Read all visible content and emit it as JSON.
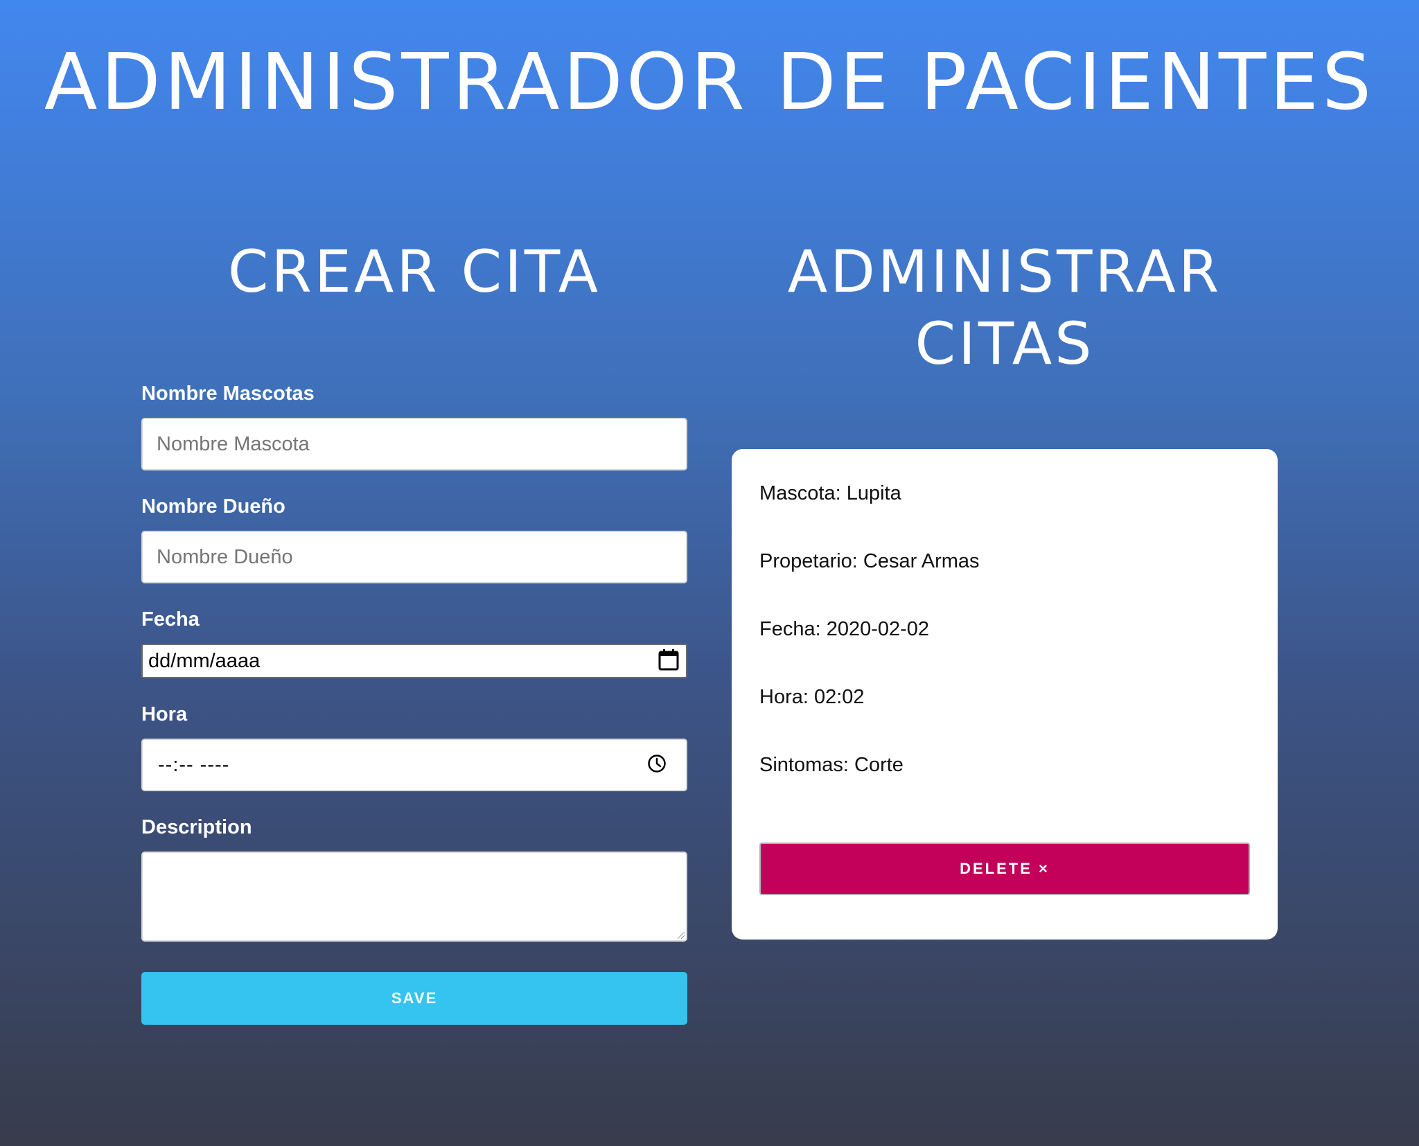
{
  "app": {
    "title": "ADMINISTRADOR DE PACIENTES"
  },
  "create": {
    "title": "CREAR CITA",
    "pet_name": {
      "label": "Nombre Mascotas",
      "placeholder": "Nombre Mascota",
      "value": ""
    },
    "owner_name": {
      "label": "Nombre Dueño",
      "placeholder": "Nombre Dueño",
      "value": ""
    },
    "date": {
      "label": "Fecha",
      "value": "dd/mm/aaaa"
    },
    "time": {
      "label": "Hora",
      "value": "--:-- ----"
    },
    "description": {
      "label": "Description",
      "value": ""
    },
    "save_label": "SAVE"
  },
  "manage": {
    "title_line1": "ADMINISTRAR",
    "title_line2": "CITAS",
    "appointment": {
      "pet": "Mascota: Lupita",
      "owner": "Propetario: Cesar Armas",
      "date": "Fecha: 2020-02-02",
      "time": "Hora: 02:02",
      "symptoms": "Sintomas: Corte"
    },
    "delete_label": "DELETE ×"
  },
  "colors": {
    "save_button": "#35c4ef",
    "delete_button": "#c3005a",
    "gradient_top": "#4287ef",
    "gradient_bottom": "#383c4c"
  },
  "icons": {
    "date_picker": "calendar-icon",
    "time_picker": "clock-icon"
  }
}
